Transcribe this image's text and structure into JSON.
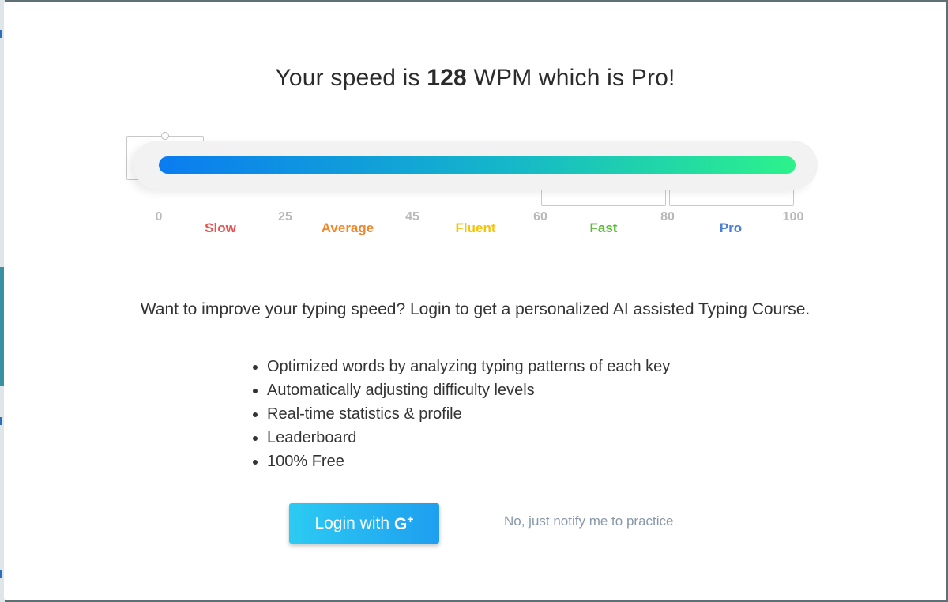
{
  "dialog": {
    "title_prefix": "Your speed is",
    "wpm": "128",
    "title_suffix": "WPM which is Pro!"
  },
  "speed_bar": {
    "progress_fraction": 1.0,
    "gradient_colors": [
      "#0a7cf0",
      "#15b7c9",
      "#2cf28a"
    ],
    "ticks": [
      "0",
      "25",
      "45",
      "60",
      "80",
      "100"
    ],
    "categories": [
      {
        "label": "Slow",
        "color": "#e8524f"
      },
      {
        "label": "Average",
        "color": "#f4862a"
      },
      {
        "label": "Fluent",
        "color": "#f5c312"
      },
      {
        "label": "Fast",
        "color": "#5dbb3a"
      },
      {
        "label": "Pro",
        "color": "#4a7fd8"
      }
    ]
  },
  "promo": {
    "text": "Want to improve your typing speed? Login to get a personalized AI assisted Typing Course.",
    "features": [
      "Optimized words by analyzing typing patterns of each key",
      "Automatically adjusting difficulty levels",
      "Real-time statistics & profile",
      "Leaderboard",
      "100% Free"
    ]
  },
  "actions": {
    "login_label": "Login with",
    "login_icon": "google-plus-icon",
    "login_icon_text": "G",
    "login_icon_plus": "+",
    "accent": "#1e9ff0",
    "notify_label": "No, just notify me to practice"
  }
}
